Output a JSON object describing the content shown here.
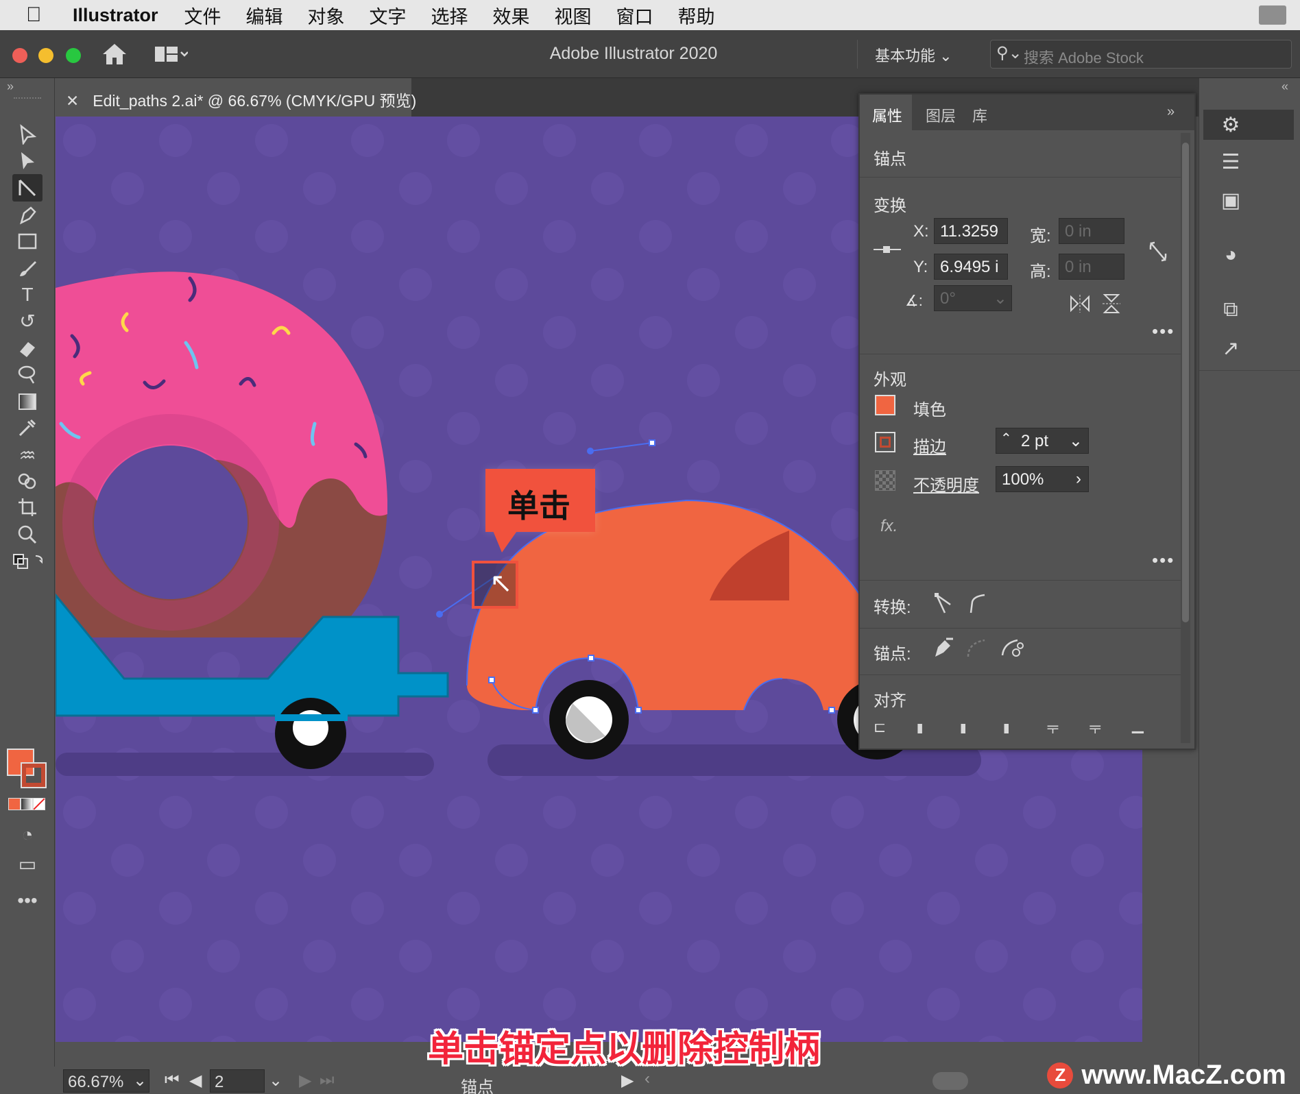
{
  "menubar": {
    "app_name": "Illustrator",
    "items": [
      "文件",
      "编辑",
      "对象",
      "文字",
      "选择",
      "效果",
      "视图",
      "窗口",
      "帮助"
    ]
  },
  "titlebar": {
    "title": "Adobe Illustrator 2020",
    "workspace": "基本功能",
    "stock_placeholder": "搜索 Adobe Stock"
  },
  "document_tab": {
    "label": "Edit_paths 2.ai* @ 66.67% (CMYK/GPU 预览)"
  },
  "panel": {
    "tabs": [
      "属性",
      "图层",
      "库"
    ],
    "selection_type": "锚点",
    "transform": {
      "heading": "变换",
      "x_label": "X:",
      "x_value": "11.3259",
      "y_label": "Y:",
      "y_value": "6.9495 i",
      "w_label": "宽:",
      "w_value": "0 in",
      "h_label": "高:",
      "h_value": "0 in",
      "angle_value": "0°"
    },
    "appearance": {
      "heading": "外观",
      "fill_label": "填色",
      "stroke_label": "描边",
      "stroke_value": "2 pt",
      "opacity_label": "不透明度",
      "opacity_value": "100%",
      "fx_label": "fx."
    },
    "convert_label": "转换:",
    "anchor_label": "锚点:",
    "align_heading": "对齐"
  },
  "status": {
    "zoom": "66.67%",
    "page": "2",
    "tool": "锚点"
  },
  "overlay": {
    "callout": "单击",
    "subtitle": "单击锚定点以删除控制柄",
    "watermark": "www.MacZ.com",
    "watermark_logo": "Z"
  },
  "colors": {
    "artboard": "#5d4a9b",
    "car": "#f06541",
    "donut_icing": "#ef4e96",
    "trailer": "#0092c8",
    "fill_swatch": "#f06541",
    "path_highlight": "#4a6df0"
  }
}
